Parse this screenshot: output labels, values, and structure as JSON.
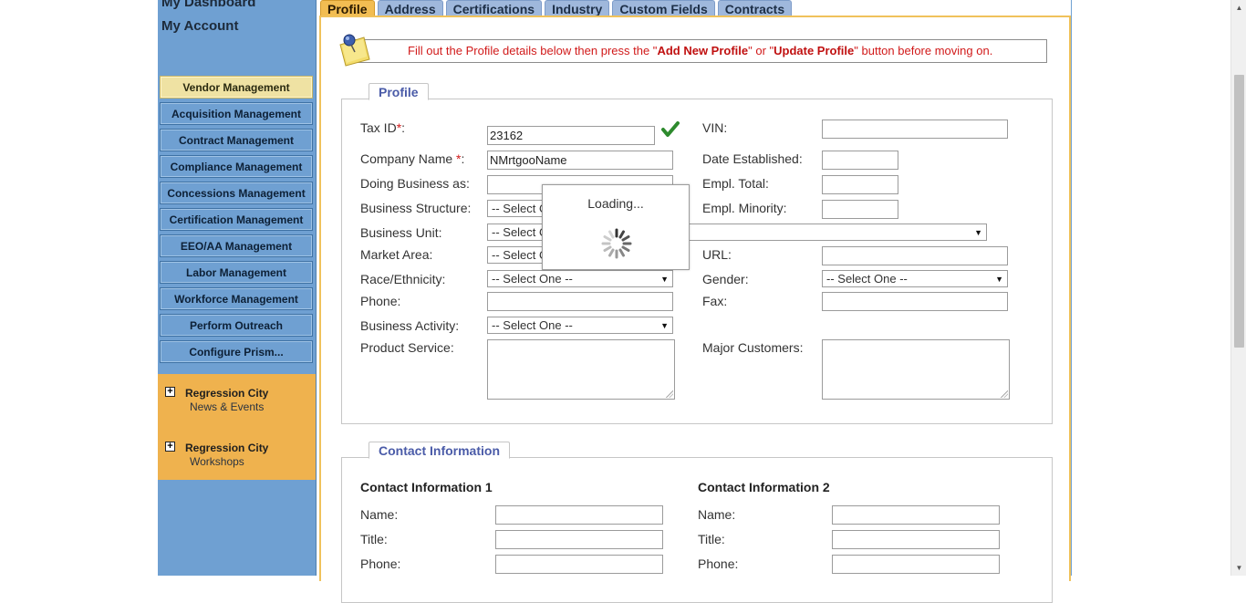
{
  "sidebar": {
    "links": [
      "My Dashboard",
      "My Account"
    ],
    "nav": [
      "Vendor Management",
      "Acquisition Management",
      "Contract Management",
      "Compliance Management",
      "Concessions Management",
      "Certification Management",
      "EEO/AA Management",
      "Labor Management",
      "Workforce Management",
      "Perform Outreach",
      "Configure Prism..."
    ],
    "active_nav": "Vendor Management",
    "news": [
      {
        "title": "Regression City",
        "subtitle": "News & Events"
      },
      {
        "title": "Regression City",
        "subtitle": "Workshops"
      }
    ]
  },
  "tabs": [
    "Profile",
    "Address",
    "Certifications",
    "Industry",
    "Custom Fields",
    "Contracts"
  ],
  "active_tab": "Profile",
  "notice": {
    "prefix": "Fill out the Profile details below then press the \"",
    "btn1": "Add New Profile",
    "mid": "\" or \"",
    "btn2": "Update Profile",
    "suffix": "\" button before moving on."
  },
  "profile": {
    "legend": "Profile",
    "tax_id": {
      "label": "Tax ID",
      "req": "*",
      "colon": ":",
      "value": "23162"
    },
    "company_name": {
      "label": "Company Name ",
      "req": "*",
      "colon": ":",
      "value": "NMrtgooName"
    },
    "doing_business_as": {
      "label": "Doing Business as:",
      "value": ""
    },
    "business_structure": {
      "label": "Business Structure:",
      "value": "-- Select O"
    },
    "business_unit": {
      "label": "Business Unit:",
      "value": "-- Select O"
    },
    "market_area": {
      "label": "Market Area:",
      "value": "-- Select O"
    },
    "race_ethnicity": {
      "label": "Race/Ethnicity:",
      "value": "-- Select One --"
    },
    "phone": {
      "label": "Phone:",
      "value": ""
    },
    "business_activity": {
      "label": "Business Activity:",
      "value": "-- Select One --"
    },
    "product_service": {
      "label": "Product Service:"
    },
    "vin": {
      "label": "VIN:",
      "value": ""
    },
    "date_established": {
      "label": "Date Established:",
      "value": ""
    },
    "empl_total": {
      "label": "Empl. Total:",
      "value": ""
    },
    "empl_minority": {
      "label": "Empl. Minority:",
      "value": ""
    },
    "url": {
      "label": "URL:",
      "value": ""
    },
    "gender": {
      "label": "Gender:",
      "value": "-- Select One --"
    },
    "fax": {
      "label": "Fax:",
      "value": ""
    },
    "major_customers": {
      "label": "Major Customers:"
    }
  },
  "contact": {
    "legend": "Contact Information",
    "c1": {
      "heading": "Contact Information 1",
      "name": "Name:",
      "title": "Title:",
      "phone": "Phone:"
    },
    "c2": {
      "heading": "Contact Information 2",
      "name": "Name:",
      "title": "Title:",
      "phone": "Phone:"
    }
  },
  "loading": {
    "text": "Loading..."
  },
  "icons": {
    "pin": "pushpin-note-icon",
    "check": "checkmark-icon",
    "spinner": "loading-spinner-icon",
    "expand": "plus-box-icon"
  },
  "colors": {
    "sidebar": "#6fa0d2",
    "active_tab": "#f2bd52",
    "notice_text": "#d11a1a",
    "legend_text": "#4a5ba8"
  }
}
